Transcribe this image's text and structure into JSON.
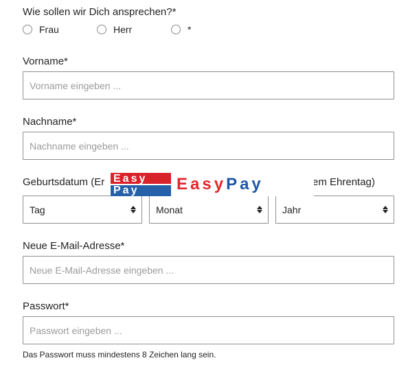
{
  "salutation": {
    "question": "Wie sollen wir Dich ansprechen?*",
    "options": [
      "Frau",
      "Herr",
      "*"
    ]
  },
  "firstname": {
    "label": "Vorname*",
    "placeholder": "Vorname eingeben ..."
  },
  "lastname": {
    "label": "Nachname*",
    "placeholder": "Nachname eingeben ..."
  },
  "birthday": {
    "label_left": "Geburtsdatum (Er",
    "label_right": "em Ehrentag)",
    "day": "Tag",
    "month": "Monat",
    "year": "Jahr"
  },
  "email": {
    "label": "Neue E-Mail-Adresse*",
    "placeholder": "Neue E-Mail-Adresse eingeben ..."
  },
  "password": {
    "label": "Passwort*",
    "placeholder": "Passwort eingeben ...",
    "hint": "Das Passwort muss mindestens 8 Zeichen lang sein."
  },
  "logo": {
    "badge_top": "Easy",
    "badge_bottom": "Pay",
    "word_part1": "Easy",
    "word_part2": "Pay",
    "colors": {
      "red": "#d8232a",
      "blue": "#2560a8"
    }
  },
  "icons": {
    "select_arrows": "updown-arrows-icon"
  }
}
